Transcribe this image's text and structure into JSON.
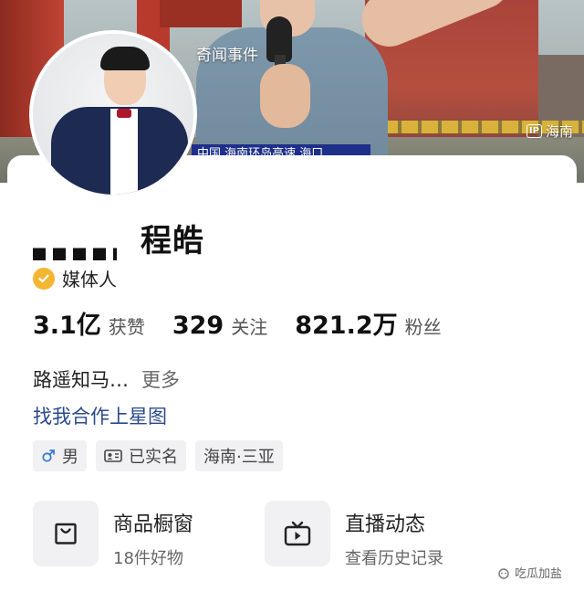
{
  "video": {
    "caption": "奇闻事件",
    "ticker": "中国  海南环岛高速  海口",
    "ip_label": "海南",
    "ip_badge": "IP"
  },
  "profile": {
    "name": "程皓",
    "verification": "媒体人",
    "stats": [
      {
        "value": "3.1亿",
        "label": "获赞"
      },
      {
        "value": "329",
        "label": "关注"
      },
      {
        "value": "821.2万",
        "label": "粉丝"
      }
    ],
    "bio": "路遥知马…",
    "bio_more": "更多",
    "xingtu_link": "找我合作上星图",
    "tags": [
      {
        "icon": "male-icon",
        "label": "男"
      },
      {
        "icon": "id-card-icon",
        "label": "已实名"
      },
      {
        "icon": "",
        "label": "海南·三亚"
      }
    ],
    "features": [
      {
        "icon": "shopping-bag-icon",
        "title": "商品橱窗",
        "subtitle": "18件好物"
      },
      {
        "icon": "tv-icon",
        "title": "直播动态",
        "subtitle": "查看历史记录"
      }
    ]
  },
  "watermark": "吃瓜加盐",
  "colors": {
    "verify_badge": "#f2b632",
    "link": "#2b4a8c",
    "ticker_bg": "#1e2f8a"
  }
}
